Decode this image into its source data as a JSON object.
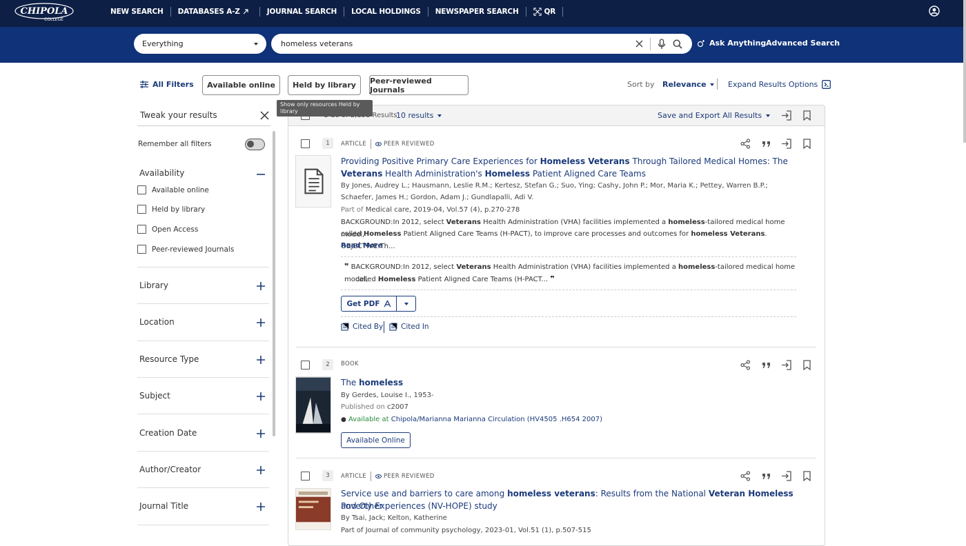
{
  "nav": {
    "logo_text": "CHIPOLA",
    "logo_sub": "COLLEGE",
    "links": [
      "NEW SEARCH",
      "DATABASES A-Z",
      "JOURNAL SEARCH",
      "LOCAL HOLDINGS",
      "NEWSPAPER SEARCH",
      "QR"
    ]
  },
  "search": {
    "scope": "Everything",
    "query": "homeless veterans",
    "ask": "Ask Anything",
    "advanced": "Advanced Search"
  },
  "filters": {
    "all": "All Filters",
    "pills": [
      "Available online",
      "Held by library",
      "Peer-reviewed Journals"
    ],
    "tooltip": "Show only resources Held by library",
    "sort_label": "Sort by",
    "sort_value": "Relevance",
    "expand": "Expand Results Options"
  },
  "sidebar": {
    "title": "Tweak your results",
    "remember": "Remember all filters",
    "availability_title": "Availability",
    "availability": [
      "Available online",
      "Held by library",
      "Open Access",
      "Peer-reviewed Journals"
    ],
    "sections": [
      "Library",
      "Location",
      "Resource Type",
      "Subject",
      "Creation Date",
      "Author/Creator",
      "Journal Title"
    ]
  },
  "results": {
    "count": "1-10 of 2,198 Results",
    "per_page": "10 results",
    "save_export": "Save and Export All Results",
    "items": [
      {
        "num": "1",
        "type": "ARTICLE",
        "peer": "PEER REVIEWED",
        "title_parts": [
          "Providing Positive Primary Care Experiences for ",
          "Homeless Veterans",
          " Through Tailored Medical Homes: The ",
          "Veterans",
          " Health Administration's ",
          "Homeless",
          " Patient Aligned Care Teams"
        ],
        "authors_1": "By Jones, Audrey L.; Hausmann, Leslie R.M.; Kertesz, Stefan G.; Suo, Ying; Cashy, John P.; Mor, Maria K.; Pettey, Warren B.P.;",
        "authors_2": "Schaefer, James H.; Gordon, Adam J.; Gundlapalli, Adi V.",
        "part_label": "Part of",
        "part": " Medical care, 2019-04, Vol.57 (4), p.270-278",
        "snippet_1": [
          "BACKGROUND:In 2012, select ",
          "Veterans",
          " Health Administration (VHA) facilities implemented a ",
          "homeless",
          "-tailored medical home model,"
        ],
        "snippet_2": [
          "called ",
          "Homeless",
          " Patient Aligned Care Teams (H-PACT), to improve care processes and outcomes for ",
          "homeless Veterans",
          ". OBJECTIVE:Th..."
        ],
        "read_more": "Read More",
        "quote_1": [
          "BACKGROUND:In 2012, select ",
          "Veterans",
          " Health Administration (VHA) facilities implemented a ",
          "homeless",
          "-tailored medical home model,"
        ],
        "quote_2": [
          "called ",
          "Homeless",
          " Patient Aligned Care Teams (H-PACT..."
        ],
        "get_pdf": "Get PDF",
        "cited_by": "Cited By",
        "cited_in": "Cited In"
      },
      {
        "num": "2",
        "type": "BOOK",
        "title_parts": [
          "The ",
          "homeless"
        ],
        "authors": "By Gerdes, Louise I., 1953-",
        "published_label": "Published on",
        "published": " c2007",
        "avail_label": "Available at ",
        "avail_loc": "Chipola/Marianna Marianna Circulation (HV4505 .H654 2007)",
        "button": "Available Online"
      },
      {
        "num": "3",
        "type": "ARTICLE",
        "peer": "PEER REVIEWED",
        "title_parts": [
          "Service use and barriers to care among ",
          "homeless veterans",
          ": Results from the National ",
          "Veteran Homeless",
          " and Other"
        ],
        "title_line2": "Poverty Experiences (NV-HOPE) study",
        "authors": "By Tsai, Jack; Kelton, Katherine",
        "part": "Part of Journal of community psychology, 2023-01, Vol.51 (1), p.507-515"
      }
    ]
  },
  "colors": {
    "nav_bg": "#0d1f45",
    "search_bg": "#0f3278",
    "link": "#1b3a7a"
  }
}
